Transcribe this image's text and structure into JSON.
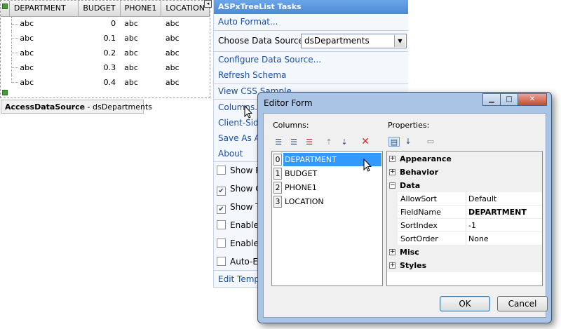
{
  "tree": {
    "columns": [
      "DEPARTMENT",
      "BUDGET",
      "PHONE1",
      "LOCATION"
    ],
    "rows": [
      [
        "abc",
        "0",
        "abc",
        "abc"
      ],
      [
        "abc",
        "0.1",
        "abc",
        "abc"
      ],
      [
        "abc",
        "0.2",
        "abc",
        "abc"
      ],
      [
        "abc",
        "0.3",
        "abc",
        "abc"
      ],
      [
        "abc",
        "0.4",
        "abc",
        "abc"
      ]
    ],
    "smart_tag_glyph": "◂",
    "datasource_type": "AccessDataSource",
    "datasource_sep": " - ",
    "datasource_name": "dsDepartments"
  },
  "tasks": {
    "title": "ASPxTreeList Tasks",
    "auto_format": "Auto Format...",
    "choose_ds_label": "Choose Data Source:",
    "choose_ds_value": "dsDepartments",
    "configure_ds": "Configure Data Source...",
    "refresh_schema": "Refresh Schema",
    "view_css": "View CSS Sample",
    "columns": "Columns...",
    "client_side": "Client-Side",
    "save_as": "Save As Au",
    "about": "About",
    "checks": [
      {
        "label": "Show Pa",
        "checked": false
      },
      {
        "label": "Show C",
        "checked": true
      },
      {
        "label": "Show Tr",
        "checked": true
      },
      {
        "label": "Enable F",
        "checked": false
      },
      {
        "label": "Enable S",
        "checked": false
      },
      {
        "label": "Auto-Ex",
        "checked": false
      }
    ],
    "edit_templates": "Edit Templ"
  },
  "dialog": {
    "title": "Editor Form",
    "columns_label": "Columns:",
    "properties_label": "Properties:",
    "columns": [
      {
        "index": "0",
        "name": "DEPARTMENT"
      },
      {
        "index": "1",
        "name": "BUDGET"
      },
      {
        "index": "2",
        "name": "PHONE1"
      },
      {
        "index": "3",
        "name": "LOCATION"
      }
    ],
    "property_groups": {
      "appearance": "Appearance",
      "behavior": "Behavior",
      "data": "Data",
      "misc": "Misc",
      "styles": "Styles"
    },
    "data_props": [
      {
        "name": "AllowSort",
        "value": "Default"
      },
      {
        "name": "FieldName",
        "value": "DEPARTMENT"
      },
      {
        "name": "SortIndex",
        "value": "-1"
      },
      {
        "name": "SortOrder",
        "value": "None"
      }
    ],
    "ok_label": "OK",
    "cancel_label": "Cancel"
  },
  "colors": {
    "accent": "#4d8ad6",
    "link": "#1b4fa3",
    "selection": "#3399ff",
    "dialog_frame": "#a9c4e4"
  }
}
